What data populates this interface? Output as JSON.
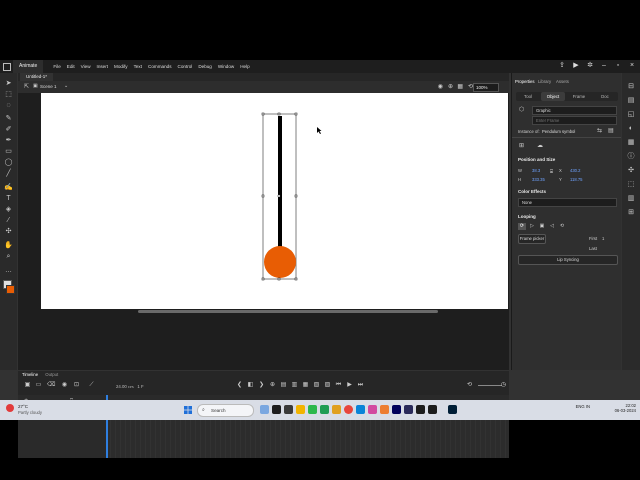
{
  "app": {
    "name": "Animate",
    "menus": [
      "File",
      "Edit",
      "View",
      "Insert",
      "Modify",
      "Text",
      "Commands",
      "Control",
      "Debug",
      "Window",
      "Help"
    ]
  },
  "document": {
    "tab_title": "Untitled-1*",
    "scene": "Scene 1",
    "zoom": "100%"
  },
  "stage": {
    "pendulum_color": "#e85d04",
    "rod_color": "#000000"
  },
  "properties": {
    "tabs": [
      "Properties",
      "Library",
      "Assets"
    ],
    "subtabs": [
      "Tool",
      "Object",
      "Frame",
      "Doc"
    ],
    "symbol_type": "Graphic",
    "instance_name_placeholder": "Enter Frame",
    "instance_of_label": "Instance of:",
    "instance_of_value": "Pendulum symbol",
    "position_size_title": "Position and Size",
    "w_label": "W",
    "w_value": "38.3",
    "x_label": "X",
    "x_value": "430.2",
    "h_label": "H",
    "h_value": "333.35",
    "y_label": "Y",
    "y_value": "118.75",
    "color_effects_title": "Color Effects",
    "color_effect_value": "None",
    "looping_title": "Looping",
    "frame_picker_label": "Frame picker",
    "first_label": "First",
    "first_value": "1",
    "last_label": "Last",
    "lip_syncing_label": "Lip Syncing"
  },
  "timeline": {
    "tabs": [
      "Timeline",
      "Output"
    ],
    "fps": "24.00",
    "fps_unit": "FPS",
    "frame": "1",
    "frame_unit": "F",
    "layer_name": "Layer_1"
  },
  "taskbar": {
    "weather_temp": "27°C",
    "weather_desc": "Partly cloudy",
    "search_label": "Search",
    "tray_lang": "ENG IN",
    "time": "22:02",
    "date": "06-03-2024"
  }
}
